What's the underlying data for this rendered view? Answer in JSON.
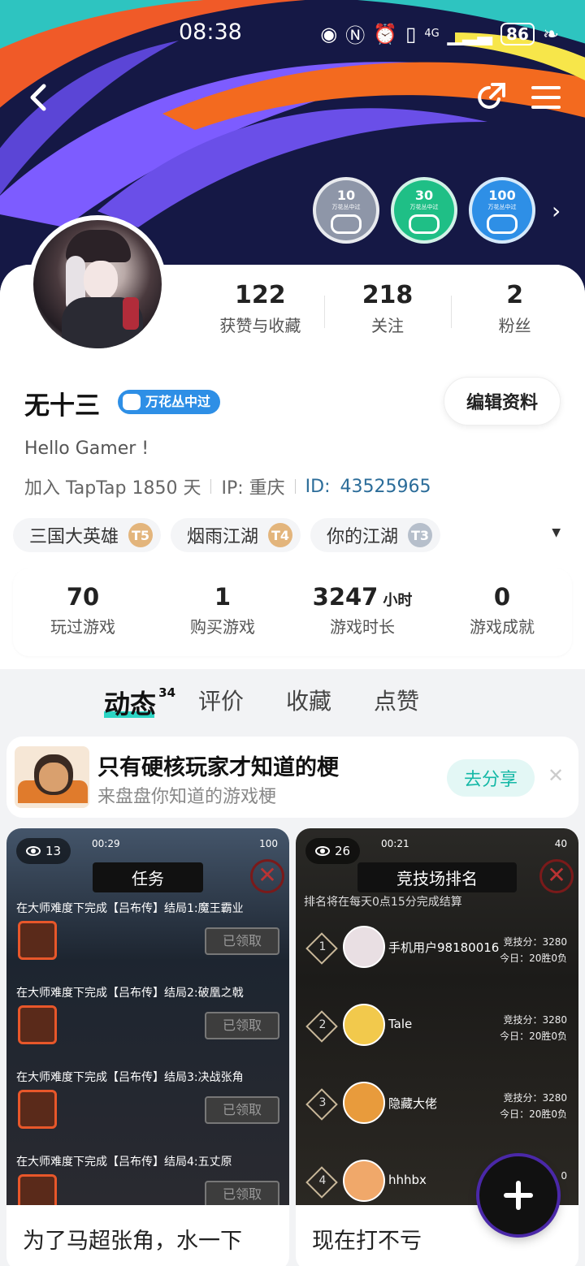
{
  "status": {
    "time": "08:38",
    "battery": "86",
    "network": "4G"
  },
  "header": {
    "back_icon": "chevron-left-icon",
    "share_icon": "share-icon",
    "menu_icon": "menu-icon"
  },
  "badges": [
    {
      "level": "10",
      "text": "万花丛中过",
      "color": "#8e96a8"
    },
    {
      "level": "30",
      "text": "万花丛中过",
      "color": "#1fbf86"
    },
    {
      "level": "100",
      "text": "万花丛中过",
      "color": "#2e8fe6"
    }
  ],
  "profile": {
    "stats": [
      {
        "value": "122",
        "label": "获赞与收藏"
      },
      {
        "value": "218",
        "label": "关注"
      },
      {
        "value": "2",
        "label": "粉丝"
      }
    ],
    "name": "无十三",
    "tag": "万花丛中过",
    "edit_label": "编辑资料",
    "bio": "Hello Gamer !",
    "joined": "加入 TapTap 1850 天",
    "ip": "IP:  重庆",
    "id_label": "ID:",
    "id_value": "43525965"
  },
  "games": [
    {
      "name": "三国大英雄",
      "tier": "T5",
      "tier_color": "#e3b57c"
    },
    {
      "name": "烟雨江湖",
      "tier": "T4",
      "tier_color": "#e3b57c"
    },
    {
      "name": "你的江湖",
      "tier": "T3",
      "tier_color": "#b6bfcb"
    }
  ],
  "game_stats": [
    {
      "value": "70",
      "unit": "",
      "label": "玩过游戏"
    },
    {
      "value": "1",
      "unit": "",
      "label": "购买游戏"
    },
    {
      "value": "3247",
      "unit": "小时",
      "label": "游戏时长"
    },
    {
      "value": "0",
      "unit": "",
      "label": "游戏成就"
    }
  ],
  "tabs": [
    {
      "label": "动态",
      "count": "34",
      "active": true
    },
    {
      "label": "评价",
      "count": "",
      "active": false
    },
    {
      "label": "收藏",
      "count": "",
      "active": false
    },
    {
      "label": "点赞",
      "count": "",
      "active": false
    }
  ],
  "promo": {
    "title": "只有硬核玩家才知道的梗",
    "subtitle": "来盘盘你知道的游戏梗",
    "share_label": "去分享",
    "close_icon": "close-icon"
  },
  "posts": [
    {
      "views": "13",
      "shot_time": "00:29",
      "shot_battery": "100",
      "screen_title": "任务",
      "tasks": [
        {
          "text": "在大师难度下完成【吕布传】结局1:魔王霸业",
          "button": "已领取"
        },
        {
          "text": "在大师难度下完成【吕布传】结局2:破凰之戟",
          "button": "已领取"
        },
        {
          "text": "在大师难度下完成【吕布传】结局3:决战张角",
          "button": "已领取"
        },
        {
          "text": "在大师难度下完成【吕布传】结局4:五丈原",
          "button": "已领取"
        }
      ],
      "caption": "为了马超张角，水一下"
    },
    {
      "views": "26",
      "shot_time": "00:21",
      "shot_battery": "40",
      "screen_title": "竞技场排名",
      "hint": "排名将在每天0点15分完成结算",
      "ranks": [
        {
          "no": "1",
          "name": "手机用户98180016",
          "score": "竞技分：3280",
          "today": "今日：20胜0负"
        },
        {
          "no": "2",
          "name": "Tale",
          "score": "竞技分：3280",
          "today": "今日：20胜0负"
        },
        {
          "no": "3",
          "name": "隐藏大佬",
          "score": "竞技分：3280",
          "today": "今日：20胜0负"
        },
        {
          "no": "4",
          "name": "hhhbx",
          "score": "0",
          "today": ""
        }
      ],
      "caption": "现在打不亏"
    }
  ],
  "fab_icon": "plus-icon"
}
